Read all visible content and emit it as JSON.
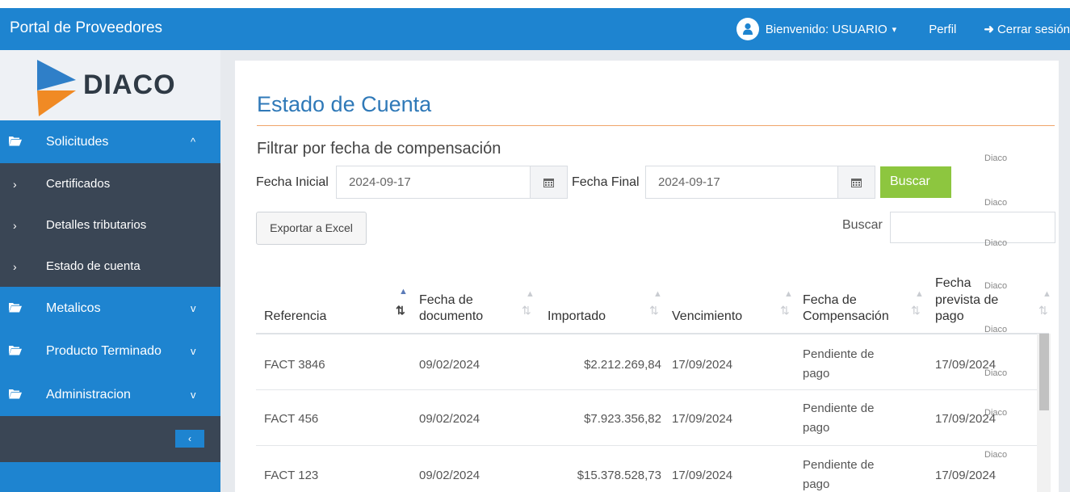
{
  "header": {
    "brand": "Portal de Proveedores",
    "welcome": "Bienvenido: USUARIO",
    "perfil": "Perfil",
    "logout": "Cerrar sesión",
    "color": "#1e84d0"
  },
  "sidebar": {
    "logo_text": "DIACO",
    "items": [
      {
        "label": "Solicitudes",
        "icon": "folder-open-icon",
        "caret": "^"
      },
      {
        "label": "Metalicos",
        "icon": "folder-open-icon",
        "caret": "v"
      },
      {
        "label": "Producto Terminado",
        "icon": "folder-open-icon",
        "caret": "v"
      },
      {
        "label": "Administracion",
        "icon": "folder-open-icon",
        "caret": "v"
      }
    ],
    "subitems": [
      "Certificados",
      "Detalles tributarios",
      "Estado de cuenta"
    ],
    "collapse_symbol": "‹"
  },
  "main": {
    "title": "Estado de Cuenta",
    "filter_title": "Filtrar por fecha de compensación",
    "fecha_inicial_label": "Fecha Inicial",
    "fecha_inicial_value": "2024-09-17",
    "fecha_final_label": "Fecha Final",
    "fecha_final_value": "2024-09-17",
    "buscar_button": "Buscar",
    "export_button": "Exportar a Excel",
    "search_label": "Buscar",
    "watermark": "Diaco",
    "accent_green": "#8dc63f"
  },
  "table": {
    "columns": [
      {
        "l1": "",
        "l2": "Referencia"
      },
      {
        "l1": "Fecha de",
        "l2": "documento"
      },
      {
        "l1": "",
        "l2": "Importado"
      },
      {
        "l1": "",
        "l2": "Vencimiento"
      },
      {
        "l1": "Fecha de",
        "l2": "Compensación"
      },
      {
        "l0": "Fecha",
        "l1": "prevista de",
        "l2": "pago"
      }
    ],
    "rows": [
      {
        "ref": "FACT 3846",
        "doc": "09/02/2024",
        "imp": "$2.212.269,84",
        "venc": "17/09/2024",
        "comp1": "Pendiente de",
        "comp2": "pago",
        "prev": "17/09/2024"
      },
      {
        "ref": "FACT 456",
        "doc": "09/02/2024",
        "imp": "$7.923.356,82",
        "venc": "17/09/2024",
        "comp1": "Pendiente de",
        "comp2": "pago",
        "prev": "17/09/2024"
      },
      {
        "ref": "FACT 123",
        "doc": "09/02/2024",
        "imp": "$15.378.528,73",
        "venc": "17/09/2024",
        "comp1": "Pendiente de",
        "comp2": "pago",
        "prev": "17/09/2024"
      }
    ]
  }
}
